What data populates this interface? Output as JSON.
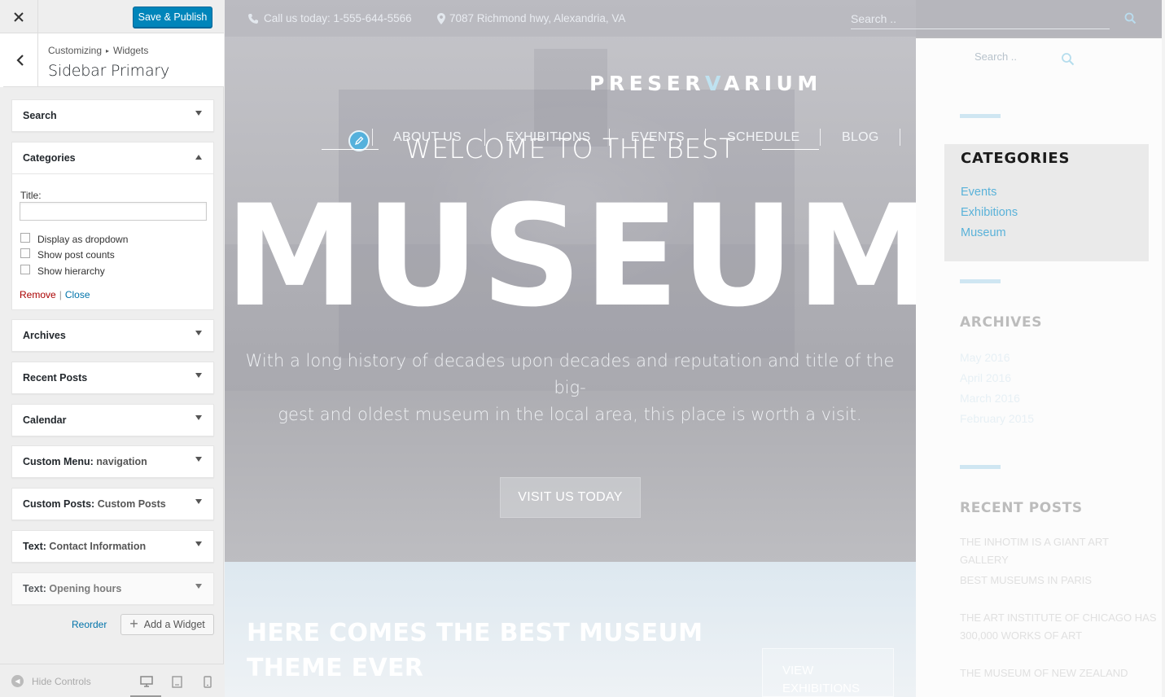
{
  "panel": {
    "close_label": "✕",
    "save_publish": "Save & Publish",
    "breadcrumb_root": "Customizing",
    "breadcrumb_sep": "▸",
    "breadcrumb_child": "Widgets",
    "section_title": "Sidebar Primary",
    "widgets": [
      {
        "title": "Search",
        "sub": ""
      },
      {
        "title": "Categories",
        "sub": ""
      },
      {
        "title": "Archives",
        "sub": ""
      },
      {
        "title": "Recent Posts",
        "sub": ""
      },
      {
        "title": "Calendar",
        "sub": ""
      },
      {
        "title": "Custom Menu:",
        "sub": "navigation"
      },
      {
        "title": "Custom Posts:",
        "sub": "Custom Posts"
      },
      {
        "title": "Text:",
        "sub": "Contact Information"
      },
      {
        "title": "Text:",
        "sub": "Opening hours"
      }
    ],
    "categories_form": {
      "title_label": "Title:",
      "title_value": "",
      "options": [
        "Display as dropdown",
        "Show post counts",
        "Show hierarchy"
      ],
      "remove": "Remove",
      "separator": "|",
      "close": "Close"
    },
    "reorder": "Reorder",
    "add_widget": "Add a Widget",
    "hide_controls": "Hide Controls"
  },
  "preview": {
    "phone": "Call us today: 1-555-644-5566",
    "address": "7087 Richmond hwy, Alexandria, VA",
    "search_placeholder": "Search ..",
    "logo_left": "PRESER",
    "logo_v": "V",
    "logo_right": "ARIUM",
    "nav": [
      "ABOUT US",
      "EXHIBITIONS",
      "EVENTS",
      "SCHEDULE",
      "BLOG"
    ],
    "welcome": "WELCOME TO THE BEST",
    "museum": "MUSEUM",
    "tagline_1": "With a long history of decades upon decades and reputation and title of the big-",
    "tagline_2": "gest and oldest museum in the local area, this place is worth a visit.",
    "visit_button": "VISIT US TODAY",
    "here_comes": "HERE COMES THE BEST MUSEUM THEME EVER",
    "view_button": "VIEW EXHIBITIONS"
  },
  "sidebar": {
    "search_placeholder": "Search ..",
    "categories_heading": "CATEGORIES",
    "categories": [
      "Events",
      "Exhibitions",
      "Museum"
    ],
    "archives_heading": "ARCHIVES",
    "archives": [
      "May 2016",
      "April 2016",
      "March 2016",
      "February 2015"
    ],
    "recent_heading": "RECENT POSTS",
    "recent": [
      "THE INHOTIM IS A GIANT ART GALLERY",
      "BEST MUSEUMS IN PARIS",
      "THE ART INSTITUTE OF CHICAGO HAS 300,000 WORKS OF ART",
      "THE MUSEUM OF NEW ZEALAND"
    ]
  },
  "colors": {
    "primary_button": "#0085ba",
    "link_blue": "#0073aa",
    "remove_red": "#aa0000",
    "theme_accent": "#55b1dc"
  }
}
